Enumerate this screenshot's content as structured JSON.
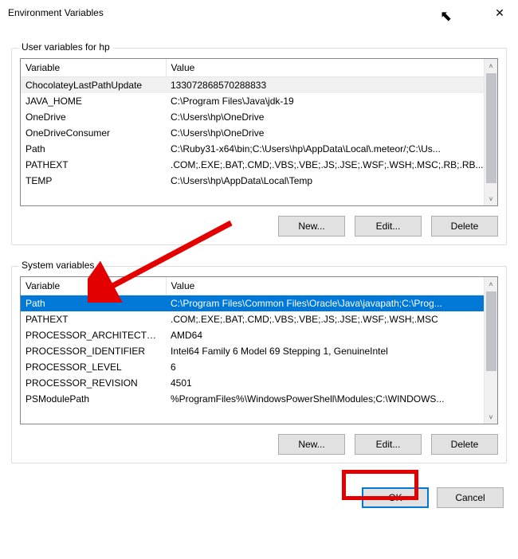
{
  "window": {
    "title": "Environment Variables",
    "close_glyph": "✕"
  },
  "cursor_glyph": "⬉",
  "user_section": {
    "label": "User variables for hp",
    "col_variable": "Variable",
    "col_value": "Value",
    "rows": [
      {
        "var": "ChocolateyLastPathUpdate",
        "val": "133072868570288833"
      },
      {
        "var": "JAVA_HOME",
        "val": "C:\\Program Files\\Java\\jdk-19"
      },
      {
        "var": "OneDrive",
        "val": "C:\\Users\\hp\\OneDrive"
      },
      {
        "var": "OneDriveConsumer",
        "val": "C:\\Users\\hp\\OneDrive"
      },
      {
        "var": "Path",
        "val": "C:\\Ruby31-x64\\bin;C:\\Users\\hp\\AppData\\Local\\.meteor/;C:\\Us..."
      },
      {
        "var": "PATHEXT",
        "val": ".COM;.EXE;.BAT;.CMD;.VBS;.VBE;.JS;.JSE;.WSF;.WSH;.MSC;.RB;.RB..."
      },
      {
        "var": "TEMP",
        "val": "C:\\Users\\hp\\AppData\\Local\\Temp"
      }
    ],
    "buttons": {
      "new": "New...",
      "edit": "Edit...",
      "delete": "Delete"
    }
  },
  "system_section": {
    "label": "System variables",
    "col_variable": "Variable",
    "col_value": "Value",
    "selected_index": 0,
    "rows": [
      {
        "var": "Path",
        "val": "C:\\Program Files\\Common Files\\Oracle\\Java\\javapath;C:\\Prog..."
      },
      {
        "var": "PATHEXT",
        "val": ".COM;.EXE;.BAT;.CMD;.VBS;.VBE;.JS;.JSE;.WSF;.WSH;.MSC"
      },
      {
        "var": "PROCESSOR_ARCHITECTU...",
        "val": "AMD64"
      },
      {
        "var": "PROCESSOR_IDENTIFIER",
        "val": "Intel64 Family 6 Model 69 Stepping 1, GenuineIntel"
      },
      {
        "var": "PROCESSOR_LEVEL",
        "val": "6"
      },
      {
        "var": "PROCESSOR_REVISION",
        "val": "4501"
      },
      {
        "var": "PSModulePath",
        "val": "%ProgramFiles%\\WindowsPowerShell\\Modules;C:\\WINDOWS..."
      }
    ],
    "buttons": {
      "new": "New...",
      "edit": "Edit...",
      "delete": "Delete"
    }
  },
  "footer": {
    "ok": "OK",
    "cancel": "Cancel"
  },
  "scroll": {
    "up": "˄",
    "down": "˅"
  }
}
